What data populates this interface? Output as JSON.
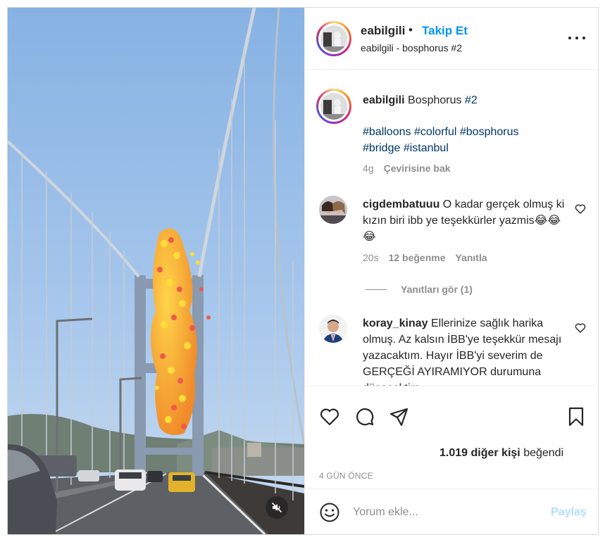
{
  "post": {
    "username": "eabilgili",
    "separator": "•",
    "follow_label": "Takip Et",
    "subtitle": "eabilgili - bosphorus #2",
    "more_icon": "more-horizontal-icon"
  },
  "caption": {
    "username": "eabilgili",
    "text": "Bosphorus",
    "tag1": "#2",
    "tags_line1": "#balloons #colorful #bosphorus",
    "tags_line2": "#bridge #istanbul",
    "time": "4g",
    "translate_label": "Çevirisine bak"
  },
  "comments": [
    {
      "username": "cigdembatuuu",
      "text": "O kadar gerçek olmuş ki kızın biri ibb ye teşekkürler yazmis😂😂😂",
      "time": "20s",
      "likes": "12 beğenme",
      "reply_label": "Yanıtla",
      "view_replies": "Yanıtları gör (1)"
    },
    {
      "username": "koray_kinay",
      "text": "Ellerinize sağlık harika olmuş. Az kalsın İBB'ye teşekkür mesajı yazacaktım. Hayır İBB'yi severim de GERÇEĞİ AYIRAMIYOR durumuna düşecektim"
    }
  ],
  "actions": {
    "icons": [
      "heart-icon",
      "comment-icon",
      "share-icon",
      "bookmark-icon"
    ],
    "likes_count": "1.019 diğer kişi",
    "likes_suffix": "beğendi",
    "time_ago": "4 GÜN ÖNCE"
  },
  "comment_box": {
    "placeholder": "Yorum ekle...",
    "share_label": "Paylaş"
  },
  "colors": {
    "accent": "#0095f6",
    "hashtag": "#00376b",
    "muted": "#8e8e8e",
    "share_disabled": "#b2dffc"
  }
}
